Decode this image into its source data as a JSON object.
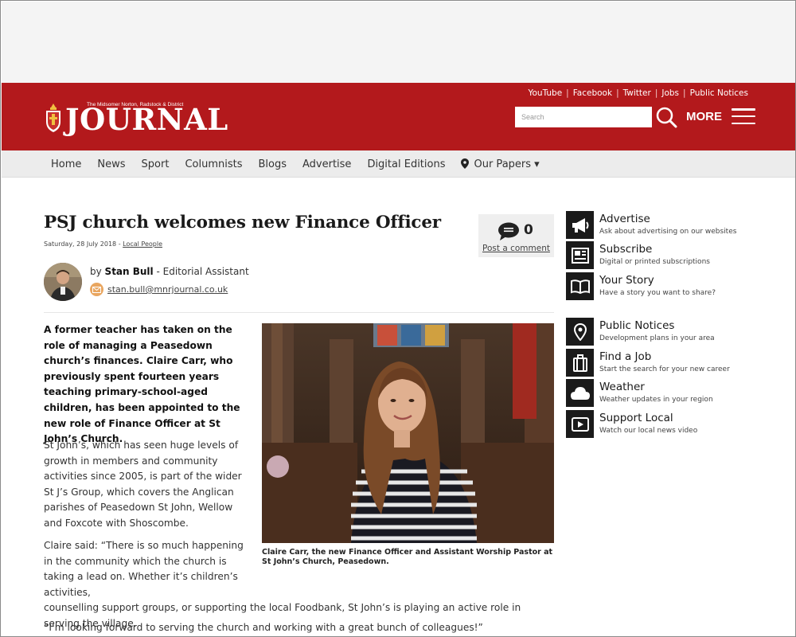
{
  "header": {
    "logo_subtitle": "The Midsomer Norton, Radstock & District",
    "logo_title": "JOURNAL",
    "top_links": [
      "YouTube",
      "Facebook",
      "Twitter",
      "Jobs",
      "Public Notices"
    ],
    "search_placeholder": "Search",
    "more_label": "MORE"
  },
  "nav": {
    "items": [
      "Home",
      "News",
      "Sport",
      "Columnists",
      "Blogs",
      "Advertise",
      "Digital Editions"
    ],
    "papers_label": "Our Papers ▾"
  },
  "article": {
    "title": "PSJ church welcomes new Finance Officer",
    "date": "Saturday, 28 July 2018",
    "category": "Local People",
    "comment_count": "0",
    "comment_link": "Post a comment",
    "author_prefix": "by",
    "author_name": "Stan Bull",
    "author_role": "- Editorial Assistant",
    "author_email": "stan.bull@mnrjournal.co.uk",
    "lead": "A former teacher has taken on the role of managing a Peasedown church’s finances. Claire Carr, who previously spent fourteen years teaching primary-school-aged children, has been appointed to the new role of Finance Officer at St John’s Church.",
    "para1": "St John’s, which has seen huge levels of growth in members and community activities since 2005, is part of the wider St J’s Group, which covers the Anglican parishes of Peasedown St John, Wellow and Foxcote with Shoscombe.",
    "para2_a": "Claire said: “There is so much happening in the community which the church is taking a lead on. Whether it’s children’s activities,",
    "para2_b": "counselling support groups, or supporting the local Foodbank, St John’s is playing an active role in serving the village.",
    "quote": "“I’m looking forward to serving the church and working with a great bunch of colleagues!”",
    "caption": "Claire Carr, the new Finance Officer and Assistant Worship Pastor at St John’s Church, Peasedown."
  },
  "sidebar": {
    "items": [
      {
        "title": "Advertise",
        "desc": "Ask about advertising on our websites",
        "icon": "megaphone-icon"
      },
      {
        "title": "Subscribe",
        "desc": "Digital or printed subscriptions",
        "icon": "newspaper-icon"
      },
      {
        "title": "Your Story",
        "desc": "Have a story you want to share?",
        "icon": "open-book-icon"
      },
      {
        "title": "Public Notices",
        "desc": "Development plans in your area",
        "icon": "map-pin-icon"
      },
      {
        "title": "Find a Job",
        "desc": "Start the search for your new career",
        "icon": "briefcase-icon"
      },
      {
        "title": "Weather",
        "desc": "Weather updates in your region",
        "icon": "cloud-icon"
      },
      {
        "title": "Support Local",
        "desc": "Watch our local news video",
        "icon": "video-icon"
      }
    ]
  },
  "colors": {
    "brand_red": "#b3191c",
    "nav_bg": "#ececec",
    "icon_bg": "#1a1a1a"
  }
}
